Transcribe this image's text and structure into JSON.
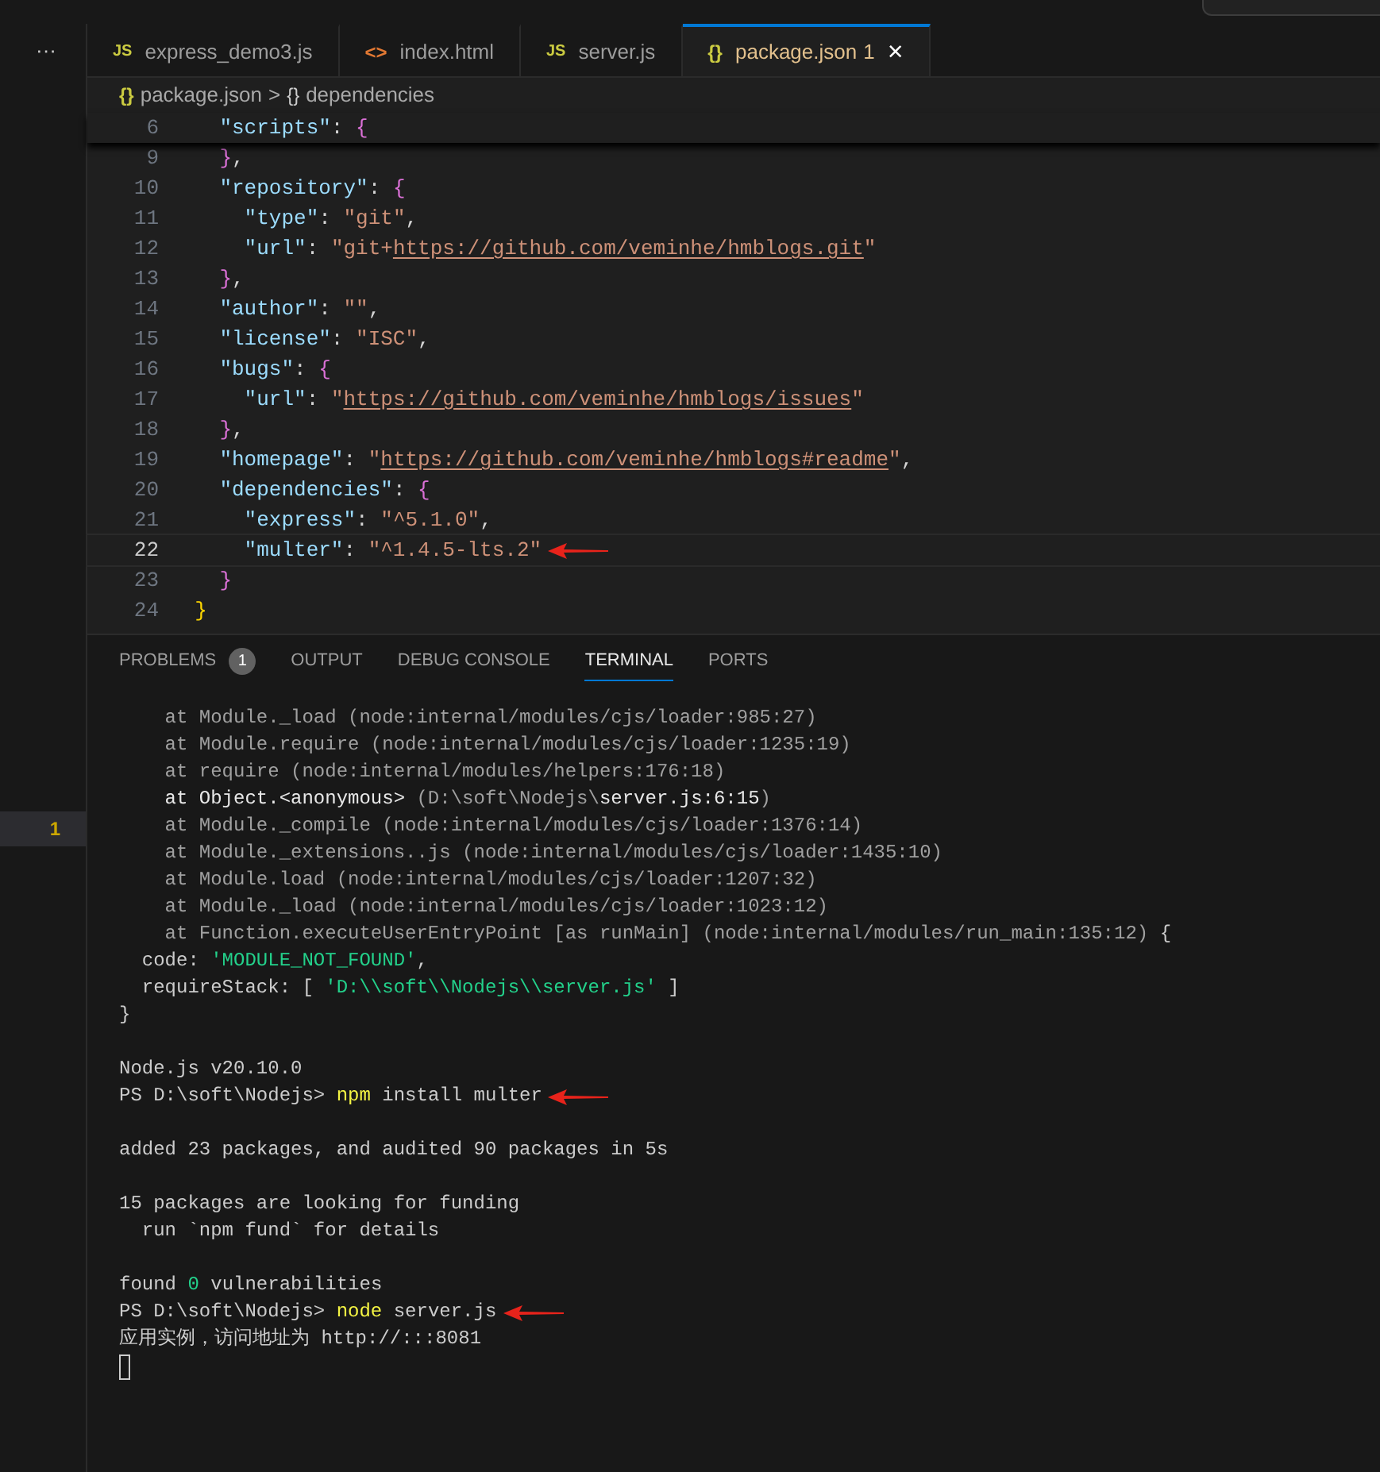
{
  "activity": {
    "more": "···",
    "problem_row": {
      "count": "1"
    }
  },
  "tabs": [
    {
      "kind": "js",
      "icon_text": "JS",
      "label": "express_demo3.js",
      "selected": false
    },
    {
      "kind": "html",
      "icon_text": "<>",
      "label": "index.html",
      "selected": false
    },
    {
      "kind": "js",
      "icon_text": "JS",
      "label": "server.js",
      "selected": false
    },
    {
      "kind": "json",
      "icon_text": "{}",
      "label": "package.json",
      "badge": "1",
      "close": "×",
      "selected": true
    }
  ],
  "breadcrumb": [
    {
      "icon_text": "{}",
      "label": "package.json"
    },
    {
      "separator": ">",
      "icon_text": "{}",
      "label": "dependencies"
    }
  ],
  "sticky_line": {
    "number": "6",
    "tokens": [
      {
        "kind": "key",
        "text": "    \"scripts\""
      },
      {
        "kind": "plain",
        "text": ": "
      },
      {
        "kind": "brace2",
        "text": "{"
      }
    ]
  },
  "lines": [
    {
      "number": "9",
      "current": false,
      "arrow": false,
      "tokens": [
        {
          "kind": "brace2",
          "text": "    }"
        },
        {
          "kind": "plain",
          "text": ","
        }
      ]
    },
    {
      "number": "10",
      "current": false,
      "arrow": false,
      "tokens": [
        {
          "kind": "key",
          "text": "    \"repository\""
        },
        {
          "kind": "plain",
          "text": ": "
        },
        {
          "kind": "brace2",
          "text": "{"
        }
      ]
    },
    {
      "number": "11",
      "current": false,
      "arrow": false,
      "tokens": [
        {
          "kind": "key",
          "text": "      \"type\""
        },
        {
          "kind": "plain",
          "text": ": "
        },
        {
          "kind": "string",
          "text": "\"git\""
        },
        {
          "kind": "plain",
          "text": ","
        }
      ]
    },
    {
      "number": "12",
      "current": false,
      "arrow": false,
      "tokens": [
        {
          "kind": "key",
          "text": "      \"url\""
        },
        {
          "kind": "plain",
          "text": ": "
        },
        {
          "kind": "string",
          "text": "\"git+"
        },
        {
          "kind": "link",
          "text": "https://github.com/veminhe/hmblogs.git"
        },
        {
          "kind": "string",
          "text": "\""
        }
      ]
    },
    {
      "number": "13",
      "current": false,
      "arrow": false,
      "tokens": [
        {
          "kind": "brace2",
          "text": "    }"
        },
        {
          "kind": "plain",
          "text": ","
        }
      ]
    },
    {
      "number": "14",
      "current": false,
      "arrow": false,
      "tokens": [
        {
          "kind": "key",
          "text": "    \"author\""
        },
        {
          "kind": "plain",
          "text": ": "
        },
        {
          "kind": "string",
          "text": "\"\""
        },
        {
          "kind": "plain",
          "text": ","
        }
      ]
    },
    {
      "number": "15",
      "current": false,
      "arrow": false,
      "tokens": [
        {
          "kind": "key",
          "text": "    \"license\""
        },
        {
          "kind": "plain",
          "text": ": "
        },
        {
          "kind": "string",
          "text": "\"ISC\""
        },
        {
          "kind": "plain",
          "text": ","
        }
      ]
    },
    {
      "number": "16",
      "current": false,
      "arrow": false,
      "tokens": [
        {
          "kind": "key",
          "text": "    \"bugs\""
        },
        {
          "kind": "plain",
          "text": ": "
        },
        {
          "kind": "brace2",
          "text": "{"
        }
      ]
    },
    {
      "number": "17",
      "current": false,
      "arrow": false,
      "tokens": [
        {
          "kind": "key",
          "text": "      \"url\""
        },
        {
          "kind": "plain",
          "text": ": "
        },
        {
          "kind": "string",
          "text": "\""
        },
        {
          "kind": "link",
          "text": "https://github.com/veminhe/hmblogs/issues"
        },
        {
          "kind": "string",
          "text": "\""
        }
      ]
    },
    {
      "number": "18",
      "current": false,
      "arrow": false,
      "tokens": [
        {
          "kind": "brace2",
          "text": "    }"
        },
        {
          "kind": "plain",
          "text": ","
        }
      ]
    },
    {
      "number": "19",
      "current": false,
      "arrow": false,
      "tokens": [
        {
          "kind": "key",
          "text": "    \"homepage\""
        },
        {
          "kind": "plain",
          "text": ": "
        },
        {
          "kind": "string",
          "text": "\""
        },
        {
          "kind": "link",
          "text": "https://github.com/veminhe/hmblogs#readme"
        },
        {
          "kind": "string",
          "text": "\""
        },
        {
          "kind": "plain",
          "text": ","
        }
      ]
    },
    {
      "number": "20",
      "current": false,
      "arrow": false,
      "tokens": [
        {
          "kind": "key",
          "text": "    \"dependencies\""
        },
        {
          "kind": "plain",
          "text": ": "
        },
        {
          "kind": "brace2",
          "text": "{"
        }
      ]
    },
    {
      "number": "21",
      "current": false,
      "arrow": false,
      "tokens": [
        {
          "kind": "key",
          "text": "      \"express\""
        },
        {
          "kind": "plain",
          "text": ": "
        },
        {
          "kind": "string",
          "text": "\"^5.1.0\""
        },
        {
          "kind": "plain",
          "text": ","
        }
      ]
    },
    {
      "number": "22",
      "current": true,
      "arrow": true,
      "tokens": [
        {
          "kind": "key",
          "text": "      \"multer\""
        },
        {
          "kind": "plain",
          "text": ": "
        },
        {
          "kind": "string",
          "text": "\"^1.4.5-lts.2\""
        }
      ]
    },
    {
      "number": "23",
      "current": false,
      "arrow": false,
      "tokens": [
        {
          "kind": "brace2",
          "text": "    }"
        }
      ]
    },
    {
      "number": "24",
      "current": false,
      "arrow": false,
      "tokens": [
        {
          "kind": "brace1",
          "text": "  }"
        }
      ]
    }
  ],
  "panel_tabs": [
    {
      "label": "PROBLEMS",
      "badge": "1",
      "selected": false
    },
    {
      "label": "OUTPUT",
      "selected": false
    },
    {
      "label": "DEBUG CONSOLE",
      "selected": false
    },
    {
      "label": "TERMINAL",
      "selected": true
    },
    {
      "label": "PORTS",
      "selected": false
    }
  ],
  "terminal": [
    {
      "kind": "text",
      "arrow": false,
      "segments": [
        {
          "kind": "dim",
          "text": "    at Module._load (node:internal/modules/cjs/loader:985:27)"
        }
      ]
    },
    {
      "kind": "text",
      "arrow": false,
      "segments": [
        {
          "kind": "dim",
          "text": "    at Module.require (node:internal/modules/cjs/loader:1235:19)"
        }
      ]
    },
    {
      "kind": "text",
      "arrow": false,
      "segments": [
        {
          "kind": "dim",
          "text": "    at require (node:internal/modules/helpers:176:18)"
        }
      ]
    },
    {
      "kind": "text",
      "arrow": false,
      "segments": [
        {
          "kind": "bright",
          "text": "    at Object.<anonymous> "
        },
        {
          "kind": "dim",
          "text": "(D:\\soft\\Nodejs\\"
        },
        {
          "kind": "bright",
          "text": "server.js:6:15"
        },
        {
          "kind": "dim",
          "text": ")"
        }
      ]
    },
    {
      "kind": "text",
      "arrow": false,
      "segments": [
        {
          "kind": "dim",
          "text": "    at Module._compile (node:internal/modules/cjs/loader:1376:14)"
        }
      ]
    },
    {
      "kind": "text",
      "arrow": false,
      "segments": [
        {
          "kind": "dim",
          "text": "    at Module._extensions..js (node:internal/modules/cjs/loader:1435:10)"
        }
      ]
    },
    {
      "kind": "text",
      "arrow": false,
      "segments": [
        {
          "kind": "dim",
          "text": "    at Module.load (node:internal/modules/cjs/loader:1207:32)"
        }
      ]
    },
    {
      "kind": "text",
      "arrow": false,
      "segments": [
        {
          "kind": "dim",
          "text": "    at Module._load (node:internal/modules/cjs/loader:1023:12)"
        }
      ]
    },
    {
      "kind": "text",
      "arrow": false,
      "segments": [
        {
          "kind": "dim",
          "text": "    at Function.executeUserEntryPoint [as runMain] (node:internal/modules/run_main:135:12) "
        },
        {
          "kind": "normal",
          "text": "{"
        }
      ]
    },
    {
      "kind": "text",
      "arrow": false,
      "segments": [
        {
          "kind": "normal",
          "text": "  code: "
        },
        {
          "kind": "green",
          "text": "'MODULE_NOT_FOUND'"
        },
        {
          "kind": "normal",
          "text": ","
        }
      ]
    },
    {
      "kind": "text",
      "arrow": false,
      "segments": [
        {
          "kind": "normal",
          "text": "  requireStack: [ "
        },
        {
          "kind": "green",
          "text": "'D:\\\\soft\\\\Nodejs\\\\server.js'"
        },
        {
          "kind": "normal",
          "text": " ]"
        }
      ]
    },
    {
      "kind": "text",
      "arrow": false,
      "segments": [
        {
          "kind": "normal",
          "text": "}"
        }
      ]
    },
    {
      "kind": "blank"
    },
    {
      "kind": "text",
      "arrow": false,
      "segments": [
        {
          "kind": "normal",
          "text": "Node.js v20.10.0"
        }
      ]
    },
    {
      "kind": "text",
      "arrow": true,
      "segments": [
        {
          "kind": "normal",
          "text": "PS D:\\soft\\Nodejs> "
        },
        {
          "kind": "yellow",
          "text": "npm"
        },
        {
          "kind": "normal",
          "text": " install multer"
        }
      ]
    },
    {
      "kind": "blank"
    },
    {
      "kind": "text",
      "arrow": false,
      "segments": [
        {
          "kind": "normal",
          "text": "added 23 packages, and audited 90 packages in 5s"
        }
      ]
    },
    {
      "kind": "blank"
    },
    {
      "kind": "text",
      "arrow": false,
      "segments": [
        {
          "kind": "normal",
          "text": "15 packages are looking for funding"
        }
      ]
    },
    {
      "kind": "text",
      "arrow": false,
      "segments": [
        {
          "kind": "normal",
          "text": "  run `npm fund` for details"
        }
      ]
    },
    {
      "kind": "blank"
    },
    {
      "kind": "text",
      "arrow": false,
      "segments": [
        {
          "kind": "normal",
          "text": "found "
        },
        {
          "kind": "green",
          "text": "0"
        },
        {
          "kind": "normal",
          "text": " vulnerabilities"
        }
      ]
    },
    {
      "kind": "text",
      "arrow": true,
      "segments": [
        {
          "kind": "normal",
          "text": "PS D:\\soft\\Nodejs> "
        },
        {
          "kind": "yellow",
          "text": "node"
        },
        {
          "kind": "normal",
          "text": " server.js"
        }
      ]
    },
    {
      "kind": "text",
      "arrow": false,
      "segments": [
        {
          "kind": "normal",
          "text": "应用实例，访问地址为 http://:::8081"
        }
      ]
    },
    {
      "kind": "cursor"
    }
  ]
}
